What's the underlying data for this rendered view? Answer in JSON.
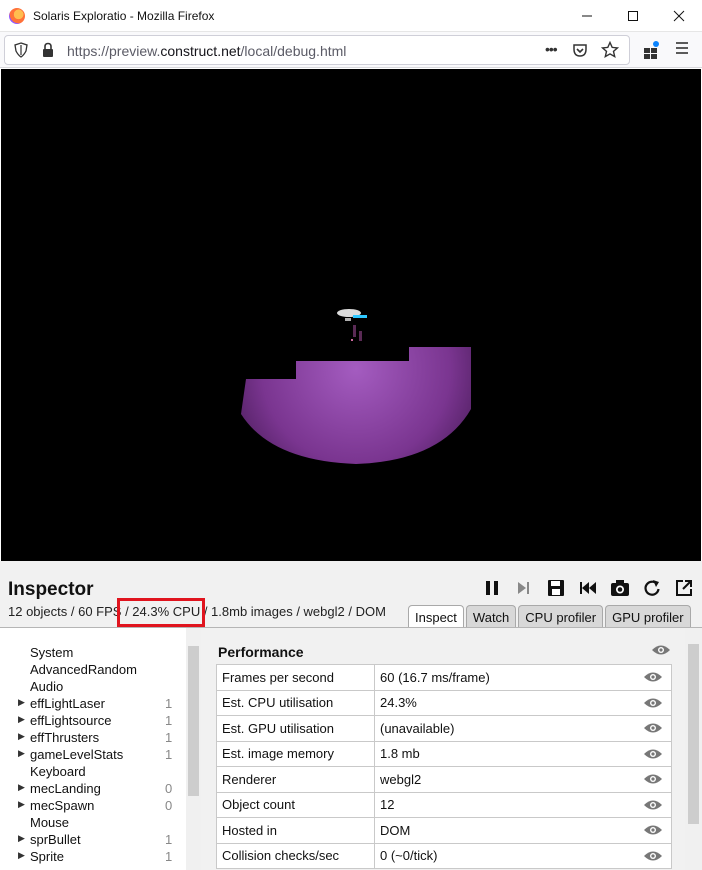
{
  "window": {
    "title": "Solaris Exploratio - Mozilla Firefox"
  },
  "navbar": {
    "url_prefix": "https://preview.",
    "url_host": "construct.net",
    "url_path": "/local/debug.html",
    "menu_dots": "•••"
  },
  "inspector": {
    "title": "Inspector",
    "stats_objects": "12 objects / 60 FPS / ",
    "stats_cpu": "24.3% CPU",
    "stats_rest": " / 1.8mb images / webgl2 / DOM",
    "tabs": [
      "Inspect",
      "Watch",
      "CPU profiler",
      "GPU profiler"
    ],
    "active_tab": "Inspect",
    "objects": [
      {
        "name": "System",
        "arrow": false,
        "count": ""
      },
      {
        "name": "AdvancedRandom",
        "arrow": false,
        "count": ""
      },
      {
        "name": "Audio",
        "arrow": false,
        "count": ""
      },
      {
        "name": "effLightLaser",
        "arrow": true,
        "count": "1"
      },
      {
        "name": "effLightsource",
        "arrow": true,
        "count": "1"
      },
      {
        "name": "effThrusters",
        "arrow": true,
        "count": "1"
      },
      {
        "name": "gameLevelStats",
        "arrow": true,
        "count": "1"
      },
      {
        "name": "Keyboard",
        "arrow": false,
        "count": ""
      },
      {
        "name": "mecLanding",
        "arrow": true,
        "count": "0"
      },
      {
        "name": "mecSpawn",
        "arrow": true,
        "count": "0"
      },
      {
        "name": "Mouse",
        "arrow": false,
        "count": ""
      },
      {
        "name": "sprBullet",
        "arrow": true,
        "count": "1"
      },
      {
        "name": "Sprite",
        "arrow": true,
        "count": "1"
      }
    ],
    "performance": {
      "title": "Performance",
      "rows": [
        {
          "key": "Frames per second",
          "value": "60 (16.7 ms/frame)"
        },
        {
          "key": "Est. CPU utilisation",
          "value": "24.3%"
        },
        {
          "key": "Est. GPU utilisation",
          "value": "(unavailable)"
        },
        {
          "key": "Est. image memory",
          "value": "1.8 mb"
        },
        {
          "key": "Renderer",
          "value": "webgl2"
        },
        {
          "key": "Object count",
          "value": "12"
        },
        {
          "key": "Hosted in",
          "value": "DOM"
        },
        {
          "key": "Collision checks/sec",
          "value": "0 (~0/tick)"
        }
      ]
    }
  },
  "colors": {
    "highlight": "#e0141e",
    "terrain": "#8a3fa0",
    "background": "#000000"
  }
}
